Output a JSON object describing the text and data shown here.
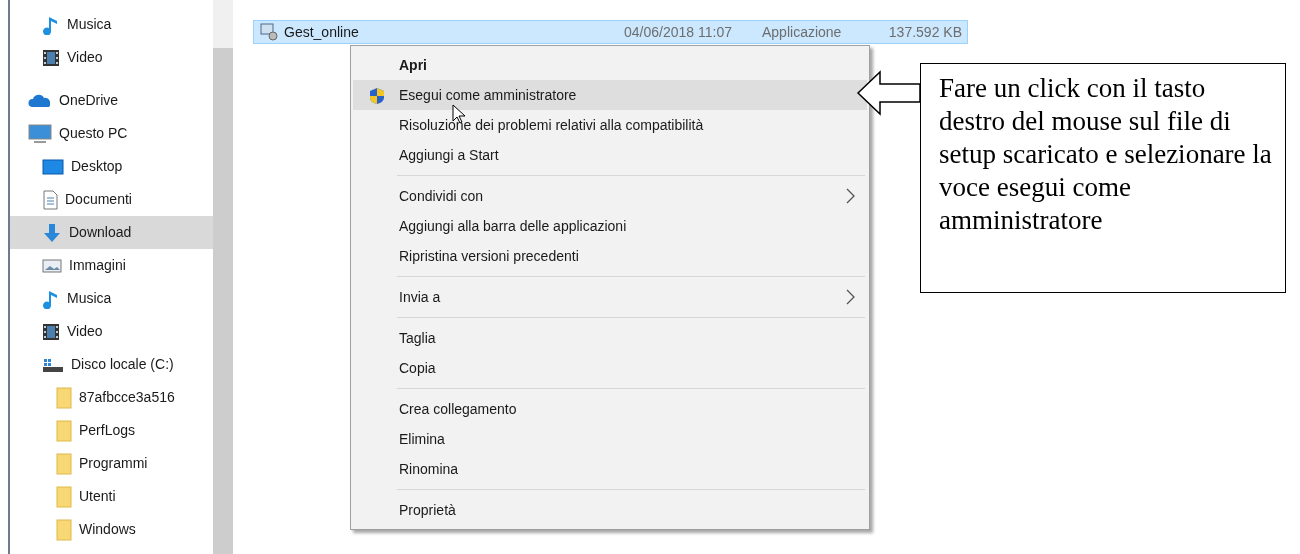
{
  "sidebar": {
    "quick_access_items": [
      {
        "label": "Musica",
        "kind": "music",
        "selected": false
      },
      {
        "label": "Video",
        "kind": "video",
        "selected": false
      }
    ],
    "tree": [
      {
        "label": "OneDrive",
        "kind": "cloud",
        "selected": false
      },
      {
        "label": "Questo PC",
        "kind": "pc",
        "selected": false,
        "children": [
          {
            "label": "Desktop",
            "kind": "desktop",
            "selected": false
          },
          {
            "label": "Documenti",
            "kind": "documents",
            "selected": false
          },
          {
            "label": "Download",
            "kind": "download",
            "selected": true
          },
          {
            "label": "Immagini",
            "kind": "pictures",
            "selected": false
          },
          {
            "label": "Musica",
            "kind": "music",
            "selected": false
          },
          {
            "label": "Video",
            "kind": "video",
            "selected": false
          },
          {
            "label": "Disco locale (C:)",
            "kind": "drive",
            "selected": false,
            "children": [
              {
                "label": "87afbcce3a516",
                "kind": "folder",
                "selected": false
              },
              {
                "label": "PerfLogs",
                "kind": "folder",
                "selected": false
              },
              {
                "label": "Programmi",
                "kind": "folder",
                "selected": false
              },
              {
                "label": "Utenti",
                "kind": "folder",
                "selected": false
              },
              {
                "label": "Windows",
                "kind": "folder",
                "selected": false
              }
            ]
          }
        ]
      }
    ]
  },
  "file_list": {
    "rows": [
      {
        "name": "Gest_online",
        "date": "04/06/2018 11:07",
        "type": "Applicazione",
        "size": "137.592 KB",
        "selected": true
      }
    ]
  },
  "context_menu": {
    "items": [
      {
        "kind": "default",
        "label": "Apri",
        "selected": false
      },
      {
        "kind": "elevated",
        "label": "Esegui come amministratore",
        "selected": true
      },
      {
        "kind": "item",
        "label": "Risoluzione dei problemi relativi alla compatibilità",
        "selected": false
      },
      {
        "kind": "item",
        "label": "Aggiungi a Start",
        "selected": false
      },
      {
        "kind": "separator"
      },
      {
        "kind": "submenu",
        "label": "Condividi con",
        "selected": false
      },
      {
        "kind": "item",
        "label": "Aggiungi alla barra delle applicazioni",
        "selected": false
      },
      {
        "kind": "item",
        "label": "Ripristina versioni precedenti",
        "selected": false
      },
      {
        "kind": "separator"
      },
      {
        "kind": "submenu",
        "label": "Invia a",
        "selected": false
      },
      {
        "kind": "separator"
      },
      {
        "kind": "item",
        "label": "Taglia",
        "selected": false
      },
      {
        "kind": "item",
        "label": "Copia",
        "selected": false
      },
      {
        "kind": "separator"
      },
      {
        "kind": "item",
        "label": "Crea collegamento",
        "selected": false
      },
      {
        "kind": "item",
        "label": "Elimina",
        "selected": false
      },
      {
        "kind": "item",
        "label": "Rinomina",
        "selected": false
      },
      {
        "kind": "separator"
      },
      {
        "kind": "item",
        "label": "Proprietà",
        "selected": false
      }
    ]
  },
  "annotation": {
    "text": "Fare un click con il tasto destro del mouse sul file di setup scaricato e selezionare la voce esegui come amministratore"
  }
}
